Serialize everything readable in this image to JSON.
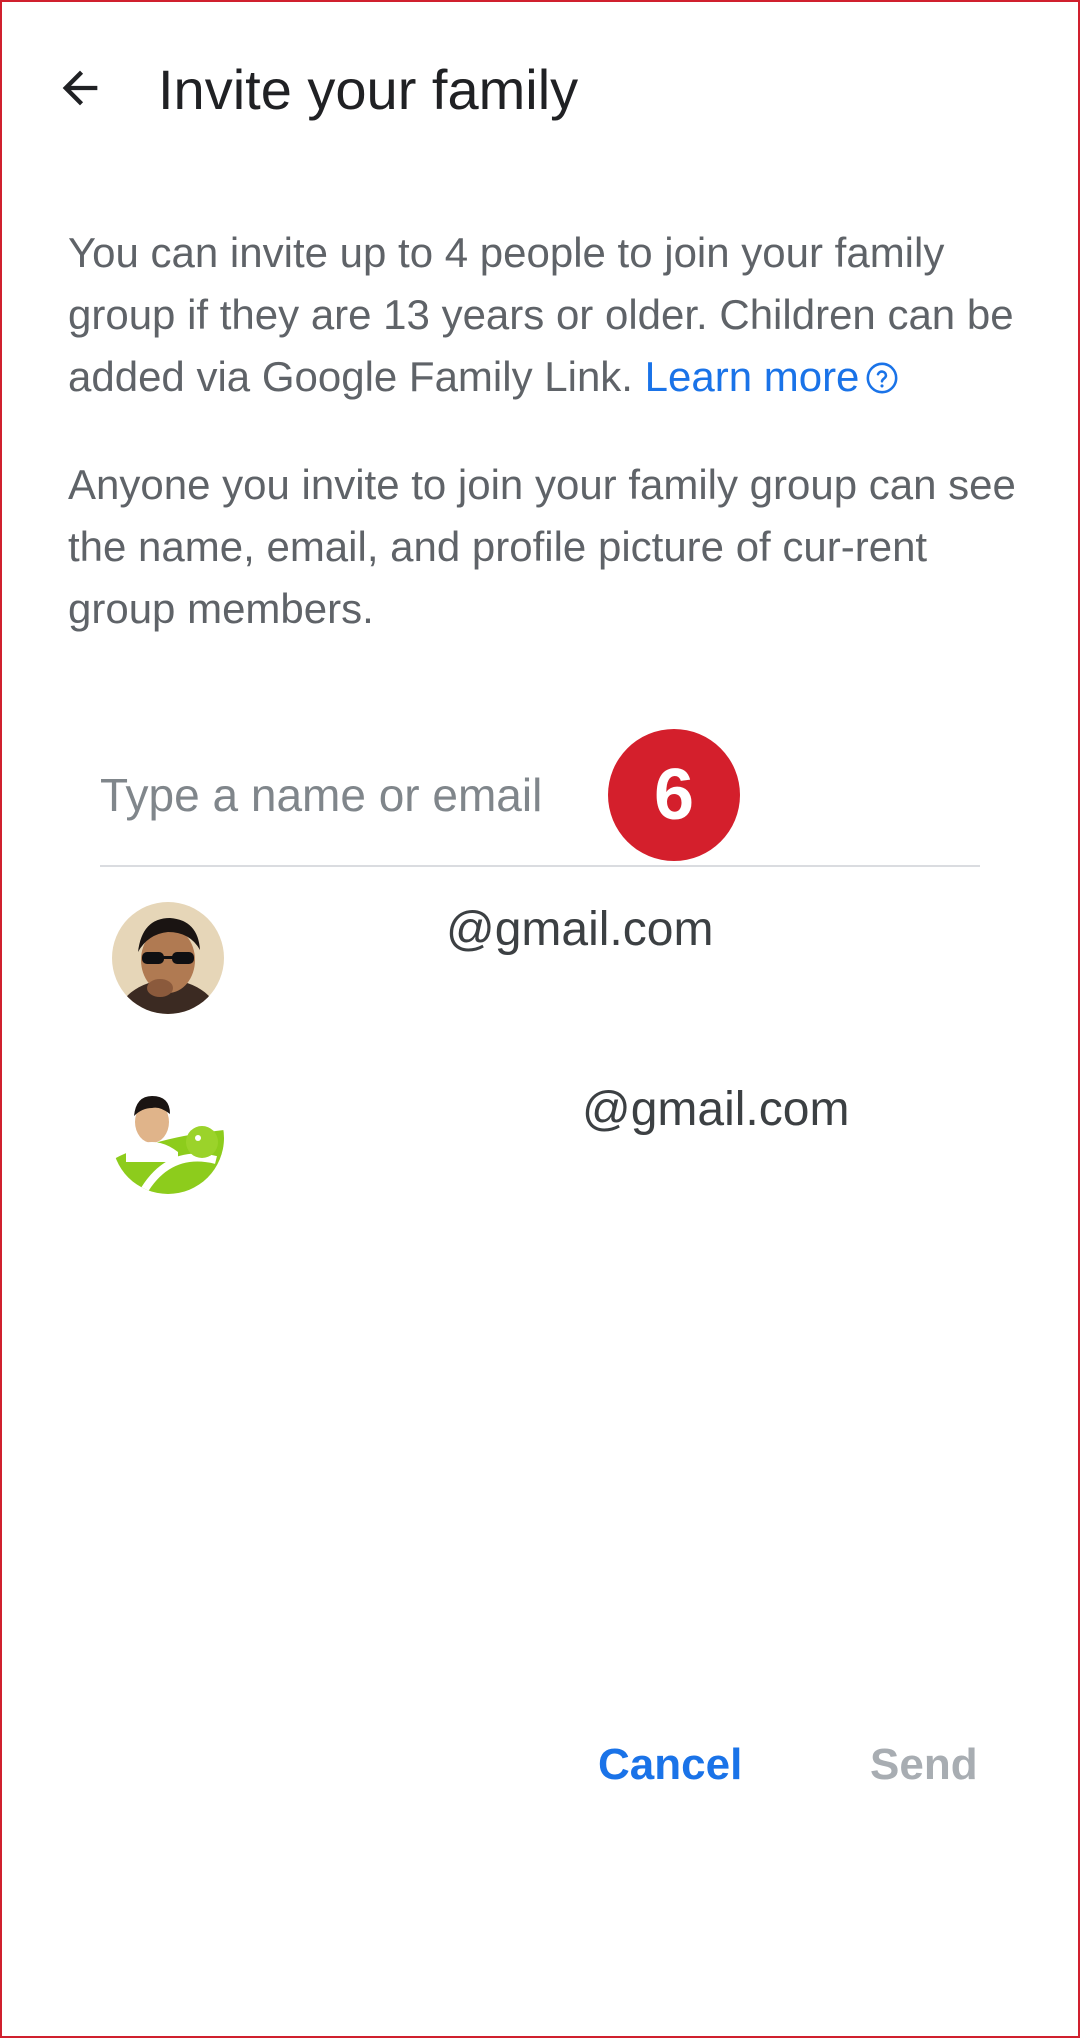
{
  "header": {
    "title": "Invite your family",
    "back_icon": "arrow-back-icon"
  },
  "intro": {
    "paragraph1_text": "You can invite up to 4 people to join your family group if they are 13 years or older. Children can be added via Google Family Link. ",
    "learn_more_label": "Learn more",
    "help_icon": "help-circle-icon",
    "paragraph2_text": "Anyone you invite to join your family group can see the name, email, and profile picture of cur-rent group members."
  },
  "search": {
    "placeholder": "Type a name or email",
    "value": ""
  },
  "badge": {
    "label": "6"
  },
  "suggestions": [
    {
      "email": "@gmail.com",
      "avatar_icon": "person-avatar-sunglasses"
    },
    {
      "email": "@gmail.com",
      "avatar_icon": "person-avatar-android"
    }
  ],
  "actions": {
    "cancel_label": "Cancel",
    "send_label": "Send"
  },
  "colors": {
    "accent": "#1a73e8",
    "badge": "#d41f2c",
    "disabled": "#a8adb2",
    "frame": "#d0202e"
  }
}
